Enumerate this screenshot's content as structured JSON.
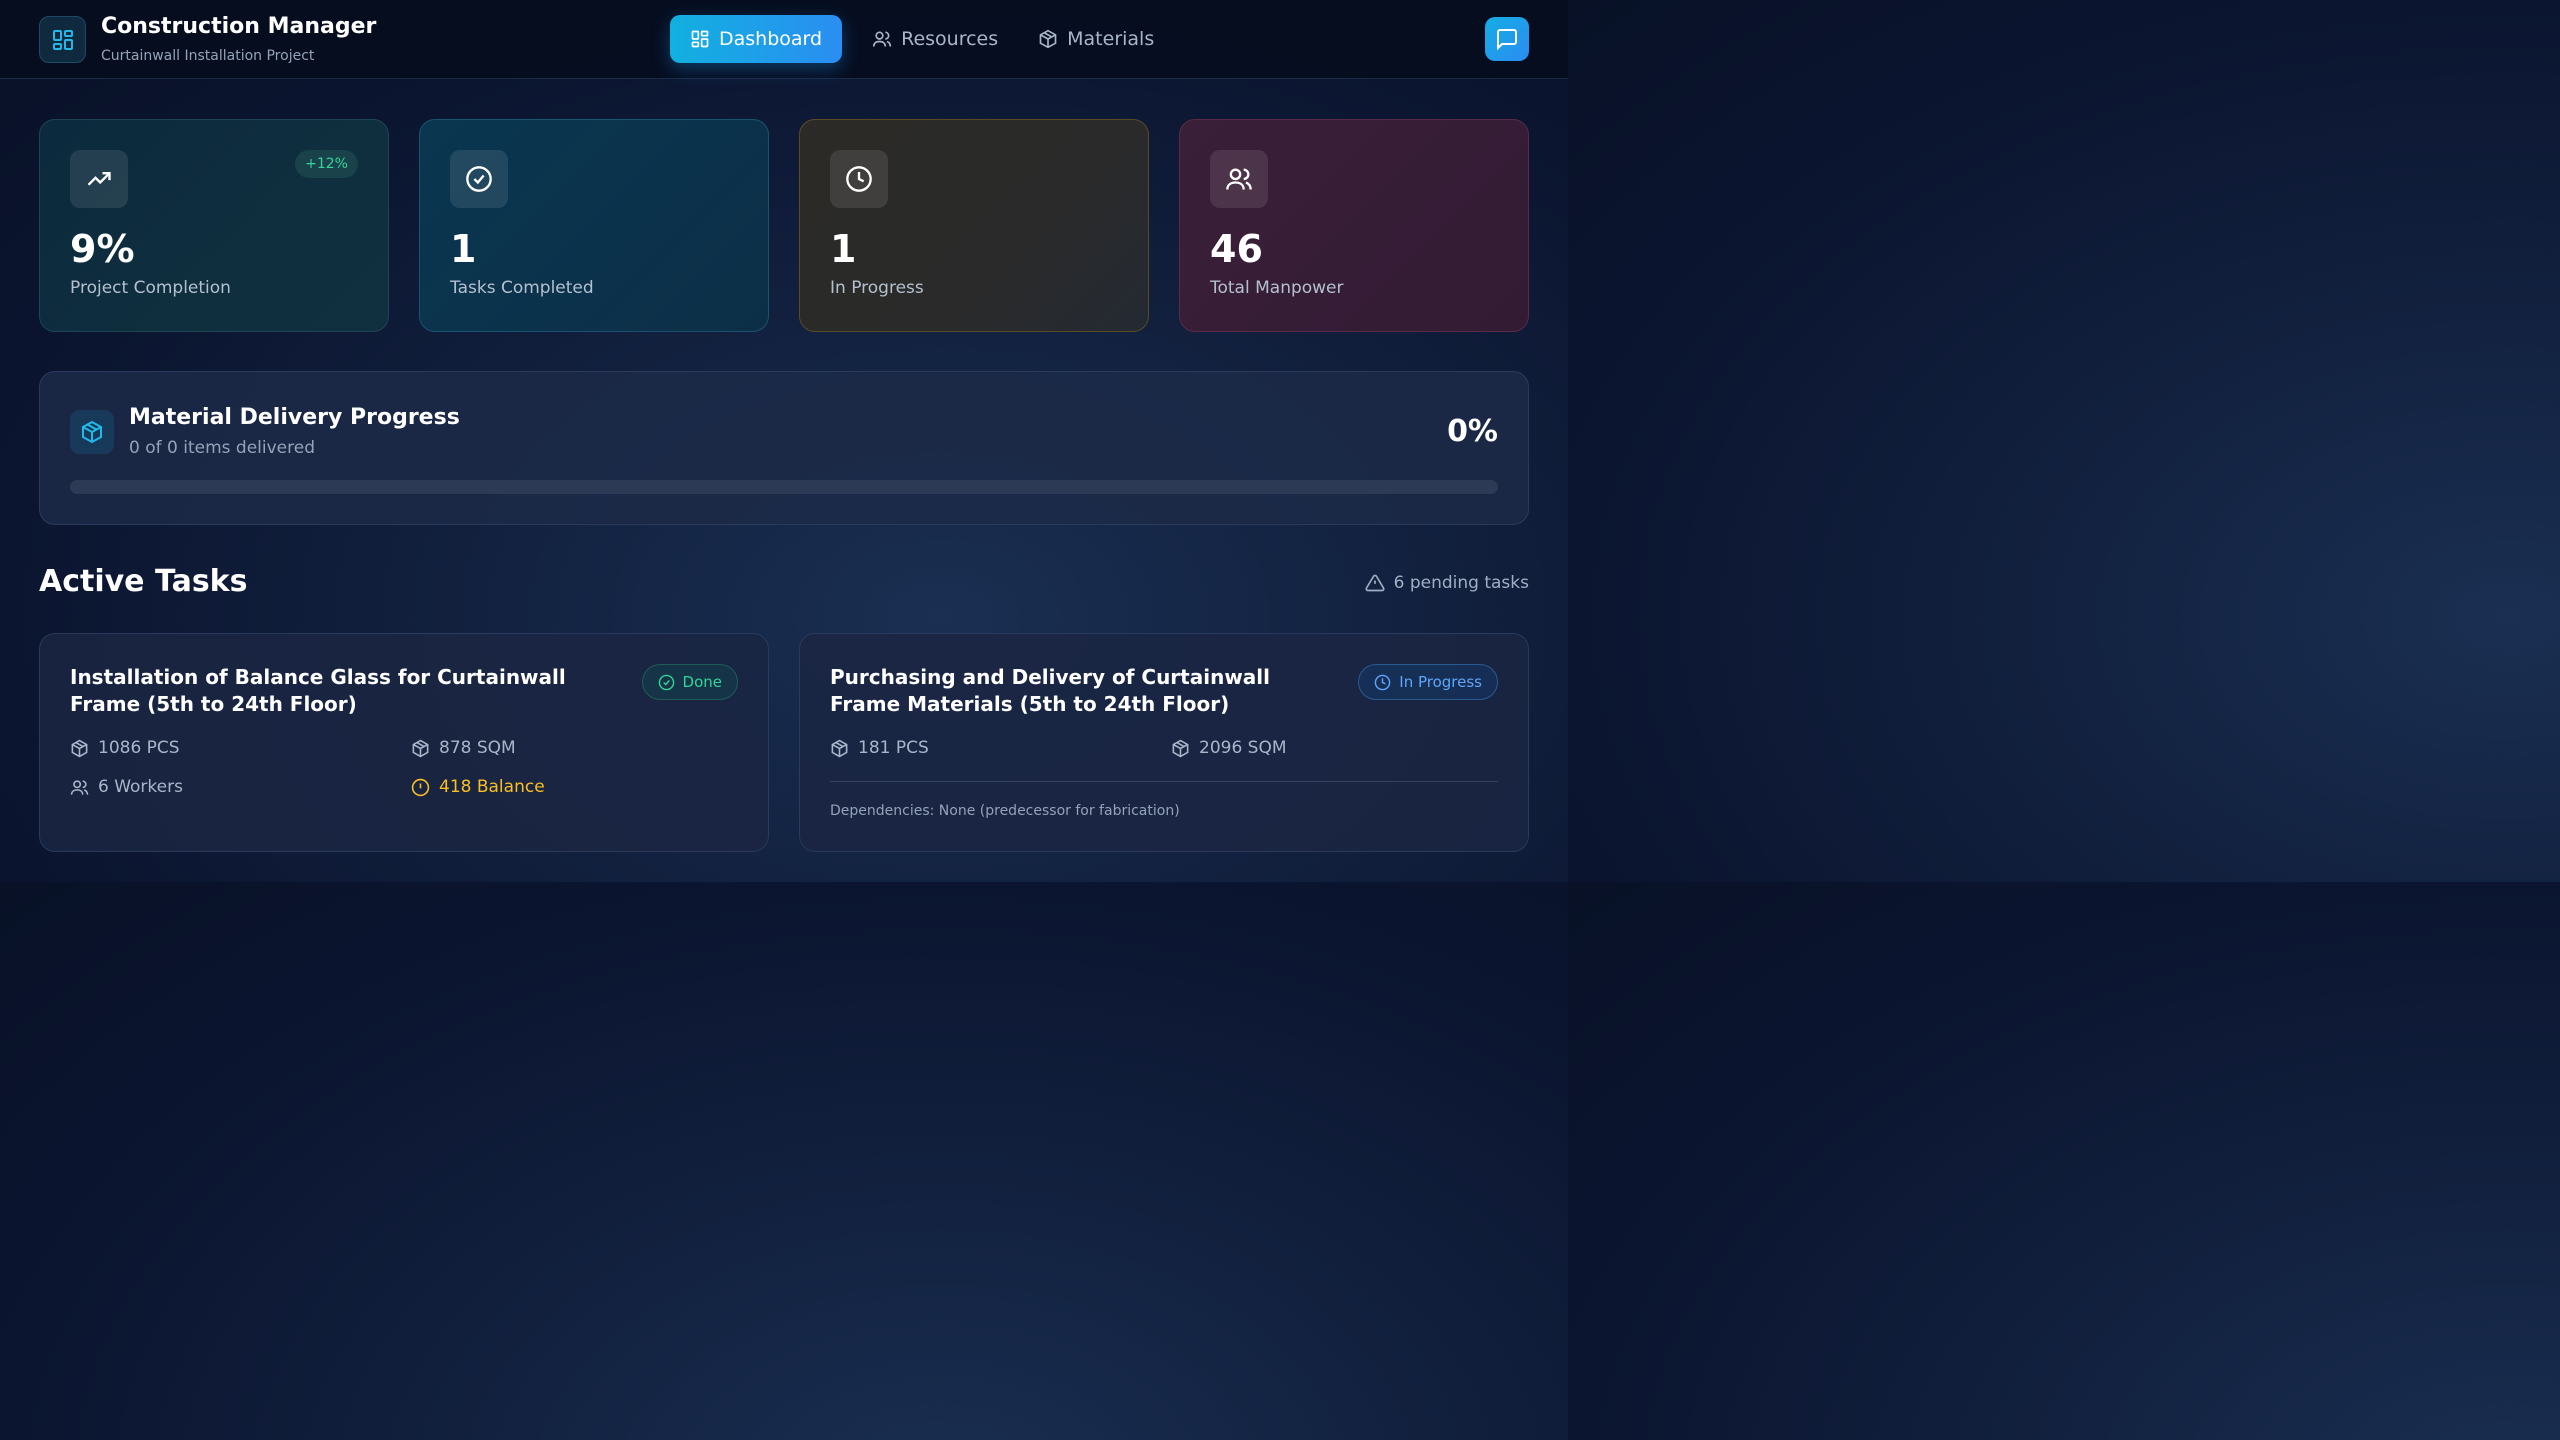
{
  "header": {
    "title": "Construction Manager",
    "subtitle": "Curtainwall Installation Project",
    "logo_icon": "layout-grid-icon",
    "chat_icon": "message-square-icon"
  },
  "nav": {
    "items": [
      {
        "label": "Dashboard",
        "icon": "layout-grid-icon",
        "active": true
      },
      {
        "label": "Resources",
        "icon": "users-icon",
        "active": false
      },
      {
        "label": "Materials",
        "icon": "package-icon",
        "active": false
      }
    ]
  },
  "stats": [
    {
      "value": "9%",
      "label": "Project Completion",
      "icon": "trending-up-icon",
      "badge": "+12%"
    },
    {
      "value": "1",
      "label": "Tasks Completed",
      "icon": "check-circle-icon"
    },
    {
      "value": "1",
      "label": "In Progress",
      "icon": "clock-icon"
    },
    {
      "value": "46",
      "label": "Total Manpower",
      "icon": "users-icon"
    }
  ],
  "delivery": {
    "title": "Material Delivery Progress",
    "subtitle": "0 of 0 items delivered",
    "percent_text": "0%",
    "progress": 0,
    "icon": "package-icon"
  },
  "tasks_section": {
    "title": "Active Tasks",
    "pending": "6 pending tasks",
    "pending_icon": "alert-triangle-icon"
  },
  "tasks": [
    {
      "title": "Installation of Balance Glass for Curtainwall Frame (5th to 24th Floor)",
      "status": "Done",
      "pcs": "1086 PCS",
      "sqm": "878 SQM",
      "workers": "6 Workers",
      "balance": "418 Balance"
    },
    {
      "title": "Purchasing and Delivery of Curtainwall Frame Materials (5th to 24th Floor)",
      "status": "In Progress",
      "pcs": "181 PCS",
      "sqm": "2096 SQM",
      "dependencies": "Dependencies: None (predecessor for fabrication)"
    }
  ],
  "colors": {
    "accent": "#1aa7e8",
    "success": "#34d399",
    "warning": "#fbbf24",
    "info": "#60a5fa"
  }
}
